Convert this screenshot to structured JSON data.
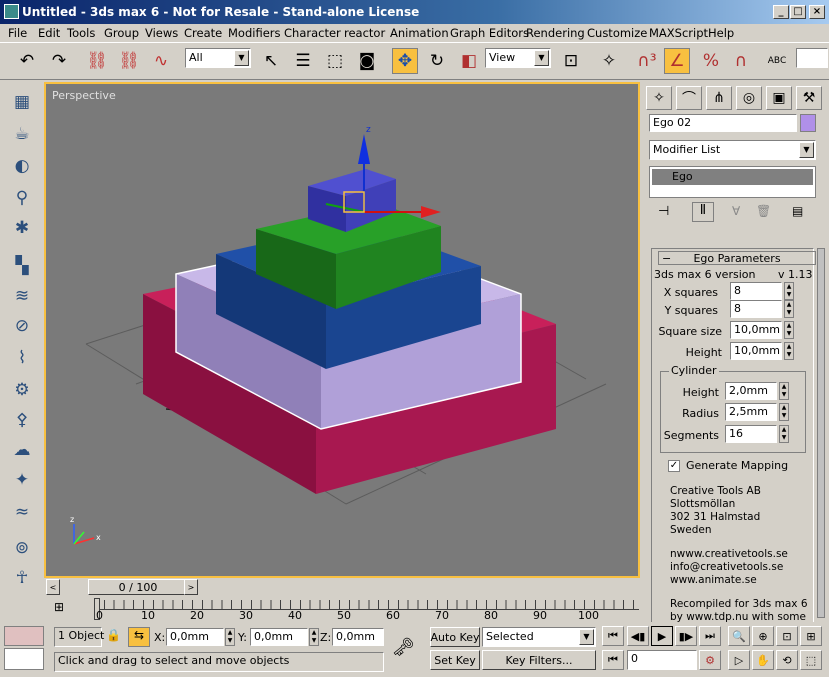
{
  "window": {
    "title": "Untitled - 3ds max 6 - Not for Resale - Stand-alone License"
  },
  "menu": [
    "File",
    "Edit",
    "Tools",
    "Group",
    "Views",
    "Create",
    "Modifiers",
    "Character",
    "reactor",
    "Animation",
    "Graph Editors",
    "Rendering",
    "Customize",
    "MAXScript",
    "Help"
  ],
  "toolbar": {
    "selection_filter": "All",
    "coord_system": "View",
    "named_sel": "ABC"
  },
  "viewport": {
    "label": "Perspective"
  },
  "command_panel": {
    "object_name": "Ego 02",
    "modifier_list": "Modifier List",
    "stack_item": "Ego",
    "rollout_title": "Ego Parameters",
    "plugin_name": "3ds max 6 version",
    "plugin_version": "v 1.13",
    "x_squares_label": "X squares",
    "x_squares": "8",
    "y_squares_label": "Y squares",
    "y_squares": "8",
    "square_size_label": "Square size",
    "square_size": "10,0mm",
    "height_label": "Height",
    "height": "10,0mm",
    "cylinder_group": "Cylinder",
    "cyl_height_label": "Height",
    "cyl_height": "2,0mm",
    "cyl_radius_label": "Radius",
    "cyl_radius": "2,5mm",
    "cyl_segments_label": "Segments",
    "cyl_segments": "16",
    "gen_mapping": "Generate Mapping",
    "credits": [
      "Creative Tools AB",
      "Slottsmöllan",
      "302 31 Halmstad",
      "Sweden",
      "",
      "nwww.creativetools.se",
      "info@creativetools.se",
      "www.animate.se",
      "",
      "Recompiled for 3ds max 6",
      "by www.tdp.nu with some"
    ]
  },
  "timeline": {
    "frame": "0 / 100",
    "ticks": [
      "0",
      "10",
      "20",
      "30",
      "40",
      "50",
      "60",
      "70",
      "80",
      "90",
      "100"
    ]
  },
  "status": {
    "selection": "1 Object",
    "x_label": "X:",
    "x": "0,0mm",
    "y_label": "Y:",
    "y": "0,0mm",
    "z_label": "Z:",
    "z": "0,0mm",
    "auto_key": "Auto Key",
    "set_key": "Set Key",
    "selected": "Selected",
    "key_filters": "Key Filters...",
    "frame_field": "0",
    "prompt": "Click and drag to select and move objects"
  },
  "colors": {
    "accent": "#f8c040",
    "viewport_bg": "#7a7a7a",
    "title_start": "#0a246a"
  }
}
